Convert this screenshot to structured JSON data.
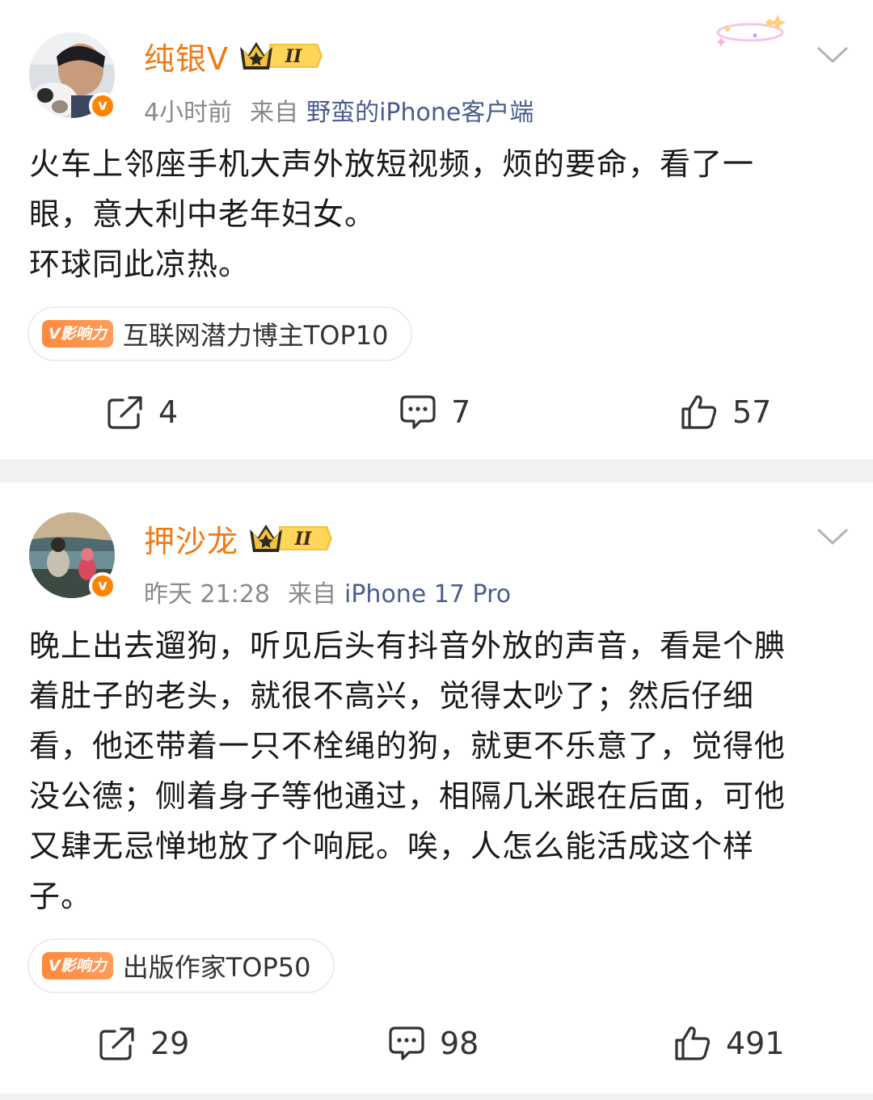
{
  "posts": [
    {
      "username": "纯银V",
      "level_badge": "II",
      "verified_mark": "v",
      "time": "4小时前",
      "from_label": "来自",
      "source": "野蛮的iPhone客户端",
      "content": "火车上邻座手机大声外放短视频，烦的要命，看了一\n眼，意大利中老年妇女。\n环球同此凉热。",
      "tag": {
        "badge": "V影响力",
        "text": "互联网潜力博主TOP10"
      },
      "actions": {
        "repost": "4",
        "comment": "7",
        "like": "57"
      }
    },
    {
      "username": "押沙龙",
      "level_badge": "II",
      "verified_mark": "v",
      "time": "昨天 21:28",
      "from_label": "来自",
      "source": "iPhone 17 Pro",
      "content": "晚上出去遛狗，听见后头有抖音外放的声音，看是个腆\n着肚子的老头，就很不高兴，觉得太吵了；然后仔细\n看，他还带着一只不栓绳的狗，就更不乐意了，觉得他\n没公德；侧着身子等他通过，相隔几米跟在后面，可他\n又肆无忌惮地放了个响屁。唉，人怎么能活成这个样\n子。",
      "tag": {
        "badge": "V影响力",
        "text": "出版作家TOP50"
      },
      "actions": {
        "repost": "29",
        "comment": "98",
        "like": "491"
      }
    }
  ],
  "colors": {
    "username": "#f07a12",
    "source_link": "#4a5c8c",
    "meta": "#8a8a8a",
    "separator": "#f1f1f1",
    "verified": "#ff8200"
  },
  "icons": [
    "crown-icon",
    "chevron-down-icon",
    "repost-icon",
    "comment-icon",
    "like-icon",
    "verified-icon"
  ]
}
